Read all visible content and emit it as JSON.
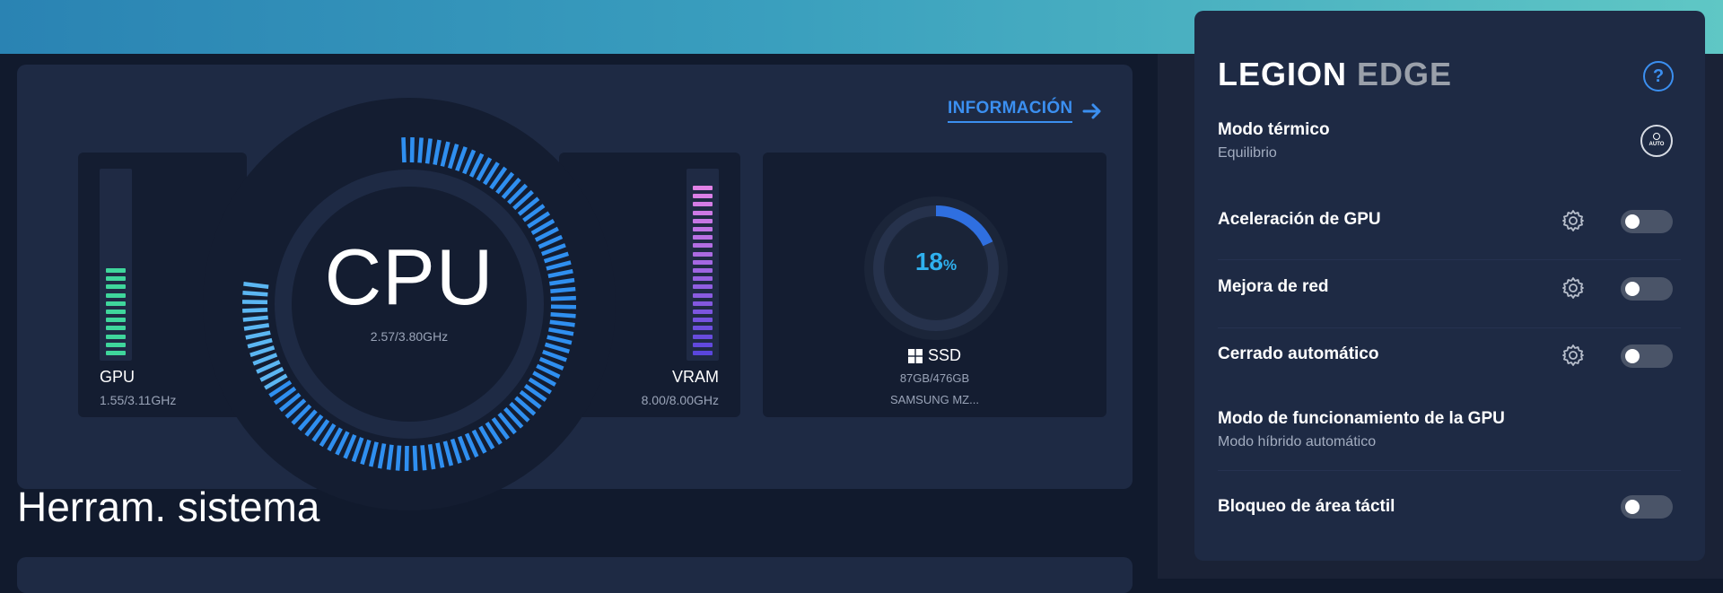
{
  "hardware": {
    "info_link": "INFORMACIÓN",
    "cpu": {
      "label": "CPU",
      "freq": "2.57/3.80GHz",
      "usage_fraction": 0.68
    },
    "gpu": {
      "label": "GPU",
      "freq": "1.55/3.11GHz",
      "usage_fraction": 0.5
    },
    "vram": {
      "label": "VRAM",
      "value": "8.00/8.00GHz",
      "usage_fraction": 1.0
    },
    "ssd": {
      "label": "SSD",
      "percent": "18",
      "percent_unit": "%",
      "capacity": "87GB/476GB",
      "model": "SAMSUNG MZ..."
    }
  },
  "section_title": "Herram. sistema",
  "legion_edge": {
    "logo_part1": "LEGION",
    "logo_part2": "EDGE",
    "help": "?",
    "auto_icon_text": "AUTO",
    "rows": [
      {
        "title": "Modo térmico",
        "subtitle": "Equilibrio"
      },
      {
        "title": "Aceleración de GPU",
        "toggle_on": false
      },
      {
        "title": "Mejora de red",
        "toggle_on": false
      },
      {
        "title": "Cerrado automático",
        "toggle_on": false
      },
      {
        "title": "Modo de funcionamiento de la GPU",
        "subtitle": "Modo híbrido automático"
      },
      {
        "title": "Bloqueo de área táctil",
        "toggle_on": false
      }
    ]
  },
  "colors": {
    "accent": "#3b8ff0",
    "gpu_bar": "#3fd69c",
    "cpu_ring": "#2f8ff0",
    "ssd_ring": "#2f6fe0"
  }
}
